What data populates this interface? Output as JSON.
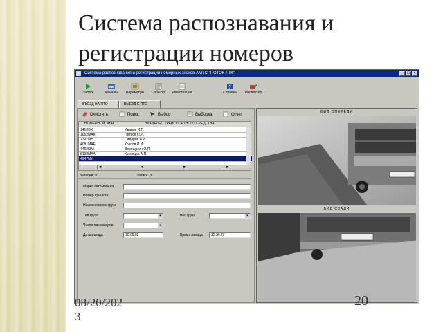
{
  "slide": {
    "title_line1": "Система распознавания и",
    "title_line2": "регистрации номеров",
    "date_line1": "08/20/202",
    "date_line2": "3",
    "page_number": "20"
  },
  "window": {
    "title": "Система распознавания и регистрации номерных знаков АМТС \"ПОТОК-ГТК\"",
    "toolbar": [
      {
        "label": "Запуск",
        "icon": "play-icon"
      },
      {
        "label": "Каналы",
        "icon": "channels-icon"
      },
      {
        "label": "Параметры",
        "icon": "parameters-icon"
      },
      {
        "label": "События",
        "icon": "events-icon"
      },
      {
        "label": "Регистрация",
        "icon": "registration-icon"
      },
      {
        "label": "Справка",
        "icon": "help-icon"
      },
      {
        "label": "Инспектор",
        "icon": "inspector-icon"
      }
    ],
    "tabs": [
      {
        "label": "ВЪЕЗД НА ПТО"
      },
      {
        "label": "ВЫЕЗД С ПТО"
      }
    ]
  },
  "list_toolbar": [
    {
      "label": "Очистить"
    },
    {
      "label": "Поиск"
    },
    {
      "label": "Выбор"
    },
    {
      "label": "Выборка"
    },
    {
      "label": "Отчет"
    }
  ],
  "table": {
    "headers": [
      "НОМЕРНОЙ ЗНАК",
      "ВЛАДЕЛЕЦ ТРАНСПОРТНОГО СРЕДСТВА"
    ],
    "rows": [
      {
        "plate": "1410ОХ",
        "owner": "Иванов И.П."
      },
      {
        "plate": "1652МАК",
        "owner": "Петров П.И."
      },
      {
        "plate": "1797МН",
        "owner": "Сидоров А.И."
      },
      {
        "plate": "4081МАЕ",
        "owner": "Козлов И.И."
      },
      {
        "plate": "4465КРА",
        "owner": "Верещагин О.П."
      },
      {
        "plate": "8198МАА",
        "owner": "Кузнецов А.П."
      },
      {
        "plate": "4947МИ",
        "owner": ""
      }
    ]
  },
  "nav": [
    "|◄",
    "◄",
    "►",
    "►|"
  ],
  "records_left": "Записей: 9",
  "records_right": "Запись: 9",
  "form": {
    "make_label": "Марка автомобиля",
    "trailer_label": "Номер прицепа",
    "cargo_name_label": "Наименование груза",
    "cargo_type_label": "Тип груза",
    "cargo_weight_label": "Вес груза",
    "passengers_label": "Число пассажиров",
    "entry_date_label": "Дата въезда",
    "entry_date_value": "10.09.02",
    "entry_time_label": "Время въезда",
    "entry_time_value": "15:36:27"
  },
  "views": {
    "front_caption": "ВИД СПЕРЕДИ",
    "rear_caption": "ВИД СЗАДИ"
  }
}
